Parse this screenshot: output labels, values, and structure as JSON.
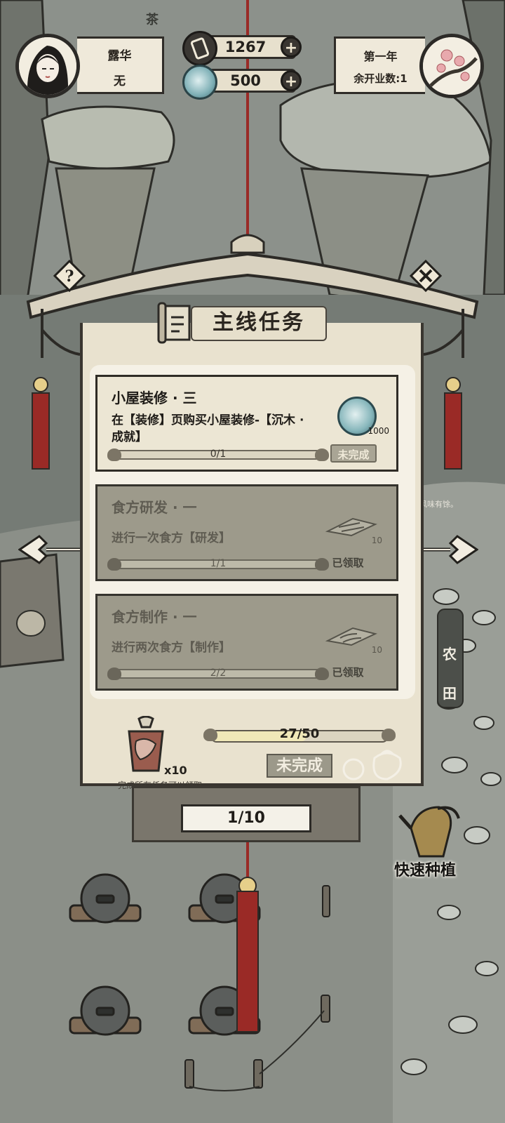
{
  "hud": {
    "player_name": "露华",
    "player_title": "无",
    "coins": "1267",
    "jade": "500",
    "year": "第一年",
    "remaining_openings": "余开业数:1",
    "building_sign": "茶"
  },
  "panel": {
    "title": "主线任务",
    "tasks": [
      {
        "title": "小屋装修 · 三",
        "desc": "在【装修】页购买小屋装修-【沉木 · 成就】",
        "progress_text": "0/1",
        "progress": 0,
        "reward_icon": "jade-gem-icon",
        "reward_amount": "1000",
        "status": "未完成"
      },
      {
        "title": "食方研发 · 一",
        "desc": "进行一次食方【研发】",
        "progress_text": "1/1",
        "progress": 1,
        "reward_icon": "recipe-board-icon",
        "reward_amount": "10",
        "status": "已领取"
      },
      {
        "title": "食方制作 · 一",
        "desc": "进行两次食方【制作】",
        "progress_text": "2/2",
        "progress": 1,
        "reward_icon": "recipe-board-icon",
        "reward_amount": "10",
        "status": "已领取"
      }
    ],
    "total_progress_text": "27/50",
    "total_progress": 0.54,
    "chest_count": "x10",
    "claim_button": "未完成",
    "claim_hint": "完成所有任务可以领取",
    "page_indicator": "1/10"
  },
  "side": {
    "farm_label": "农田",
    "quick_plant_label": "快速种植",
    "flavor_text": "风味有馀。"
  },
  "colors": {
    "panel_bg": "#e9e2cf",
    "tassel_red": "#9a2a26",
    "ink": "#2f2c28"
  }
}
